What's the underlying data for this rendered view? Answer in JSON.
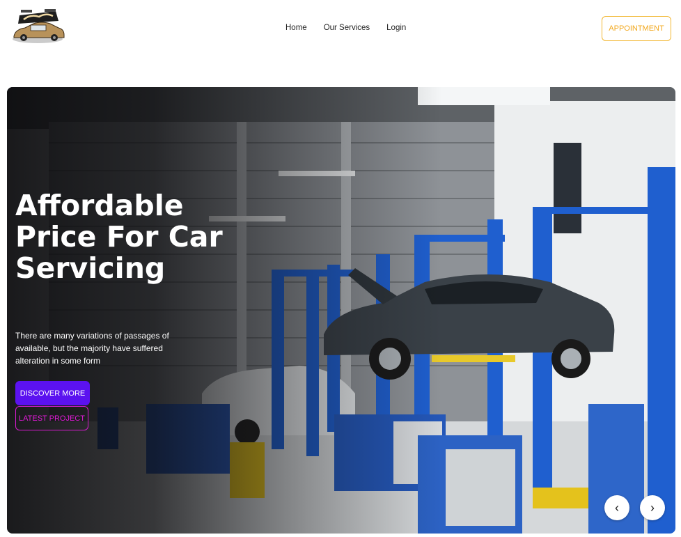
{
  "header": {
    "logo_alt": "Rimex logo",
    "nav": [
      {
        "label": "Home"
      },
      {
        "label": "Our Services"
      },
      {
        "label": "Login"
      }
    ],
    "appointment_label": "APPOINTMENT"
  },
  "hero": {
    "title": "Affordable Price For Car Servicing",
    "description": "There are many variations of passages of available, but the majority have suffered alteration in some form",
    "discover_label": "DISCOVER MORE",
    "latest_label": "LATEST PROJECT",
    "prev_icon": "chevron-left-icon",
    "next_icon": "chevron-right-icon"
  },
  "colors": {
    "accent_yellow": "#f2b731",
    "primary_purple": "#5b12f0",
    "magenta": "#d81bd0"
  }
}
